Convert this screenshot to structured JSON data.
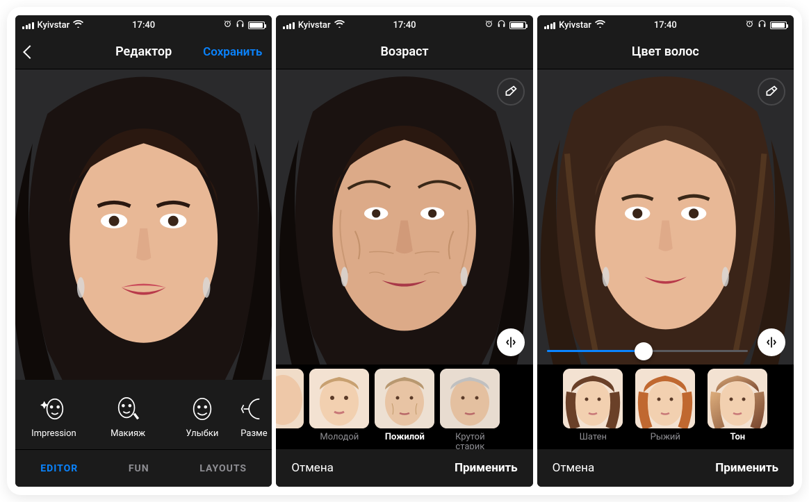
{
  "status": {
    "carrier": "Kyivstar",
    "time": "17:40"
  },
  "screen1": {
    "nav_title": "Редактор",
    "nav_save": "Сохранить",
    "tools": [
      {
        "label": "Impression"
      },
      {
        "label": "Макияж"
      },
      {
        "label": "Улыбки"
      },
      {
        "label": "Разме"
      }
    ],
    "tabs": {
      "editor": "EDITOR",
      "fun": "FUN",
      "layouts": "LAYOUTS"
    }
  },
  "screen2": {
    "nav_title": "Возраст",
    "thumbs": [
      {
        "label": "Молодой"
      },
      {
        "label": "Пожилой"
      },
      {
        "label": "Крутой старик"
      }
    ],
    "cancel": "Отмена",
    "apply": "Применить"
  },
  "screen3": {
    "nav_title": "Цвет волос",
    "slider_value": 48,
    "thumbs": [
      {
        "label": "Шатен"
      },
      {
        "label": "Рыжий"
      },
      {
        "label": "Тон"
      }
    ],
    "cancel": "Отмена",
    "apply": "Применить"
  }
}
